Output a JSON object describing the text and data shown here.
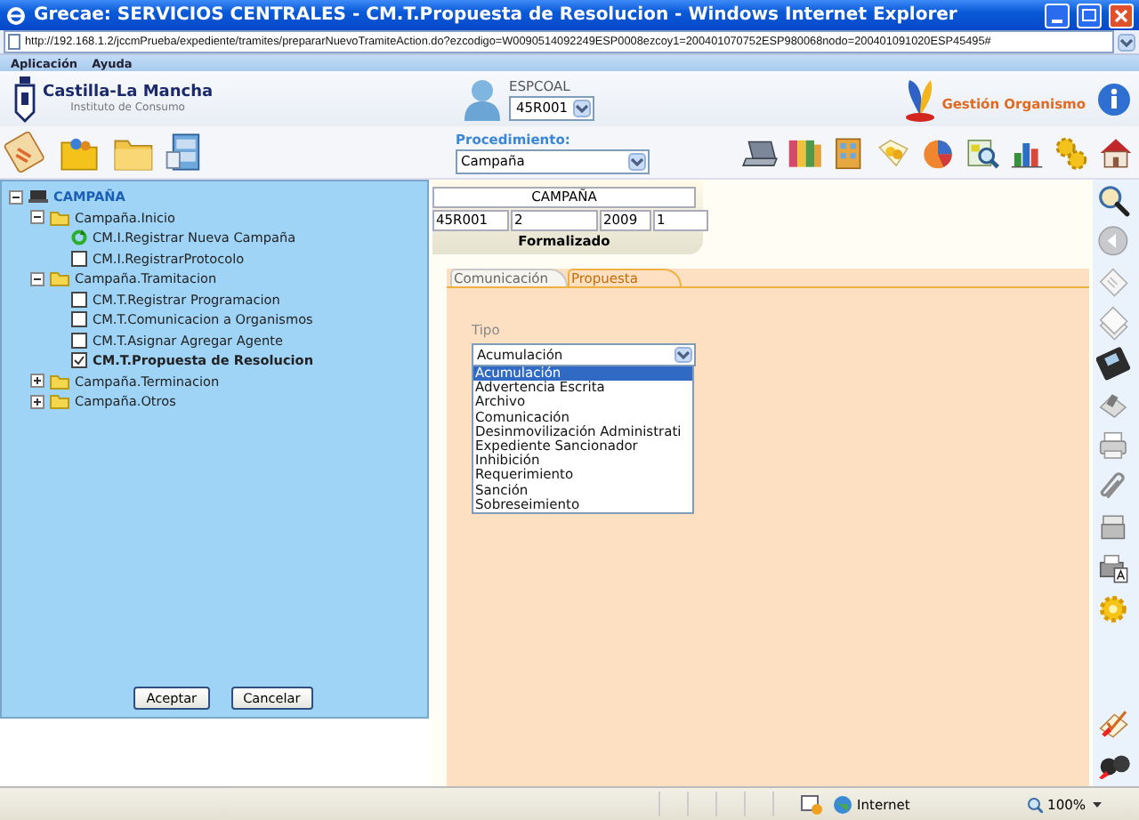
{
  "window": {
    "title": "Grecae: SERVICIOS CENTRALES - CM.T.Propuesta de Resolucion - Windows Internet Explorer"
  },
  "address": {
    "url": "http://192.168.1.2/jccmPrueba/expediente/tramites/prepararNuevoTramiteAction.do?ezcodigo=W0090514092249ESP0008ezcoy1=200401070752ESP980068nodo=200401091020ESP45495#"
  },
  "menu": [
    "Aplicación",
    "Ayuda"
  ],
  "header": {
    "org_name": "Castilla-La Mancha",
    "org_subtitle": "Instituto de Consumo",
    "user": "ESPCOAL",
    "office": "45R001",
    "link": "Gestión Organismo"
  },
  "toolbar": {
    "procedure_label": "Procedimiento:",
    "procedure": "Campaña"
  },
  "tree": {
    "label": "CAMPAÑA",
    "kind": "root",
    "expanded": true,
    "children": [
      {
        "label": "Campaña.Inicio",
        "kind": "folder",
        "expanded": true,
        "children": [
          {
            "label": "CM.I.Registrar Nueva Campaña",
            "kind": "current"
          },
          {
            "label": "CM.I.RegistrarProtocolo",
            "kind": "task",
            "checked": false
          }
        ]
      },
      {
        "label": "Campaña.Tramitacion",
        "kind": "folder",
        "expanded": true,
        "children": [
          {
            "label": "CM.T.Registrar Programacion",
            "kind": "task",
            "checked": false
          },
          {
            "label": "CM.T.Comunicacion a Organismos",
            "kind": "task",
            "checked": false
          },
          {
            "label": "CM.T.Asignar Agregar Agente",
            "kind": "task",
            "checked": false
          },
          {
            "label": "CM.T.Propuesta de Resolucion",
            "kind": "task",
            "checked": true
          }
        ]
      },
      {
        "label": "Campaña.Terminacion",
        "kind": "folder",
        "expanded": false
      },
      {
        "label": "Campaña.Otros",
        "kind": "folder",
        "expanded": false
      }
    ]
  },
  "tree_buttons": [
    "Aceptar",
    "Cancelar"
  ],
  "record": {
    "title": "CAMPAÑA",
    "fields": [
      "45R001",
      "2",
      "2009",
      "1"
    ],
    "status": "Formalizado"
  },
  "tabs": [
    {
      "label": "Comunicación",
      "selected": false
    },
    {
      "label": "Propuesta",
      "selected": true
    }
  ],
  "tipo": {
    "label": "Tipo",
    "value": "Acumulación",
    "options": [
      {
        "label": "Acumulación",
        "selected": true
      },
      {
        "label": "Advertencia Escrita",
        "selected": false
      },
      {
        "label": "Archivo",
        "selected": false
      },
      {
        "label": "Comunicación",
        "selected": false
      },
      {
        "label": "Desinmovilización Administrati",
        "selected": false
      },
      {
        "label": "Expediente Sancionador",
        "selected": false
      },
      {
        "label": "Inhibición",
        "selected": false
      },
      {
        "label": "Requerimiento",
        "selected": false
      },
      {
        "label": "Sanción",
        "selected": false
      },
      {
        "label": "Sobreseimiento",
        "selected": false
      }
    ]
  },
  "status_bar": {
    "zone": "Internet",
    "zoom": "100%"
  }
}
